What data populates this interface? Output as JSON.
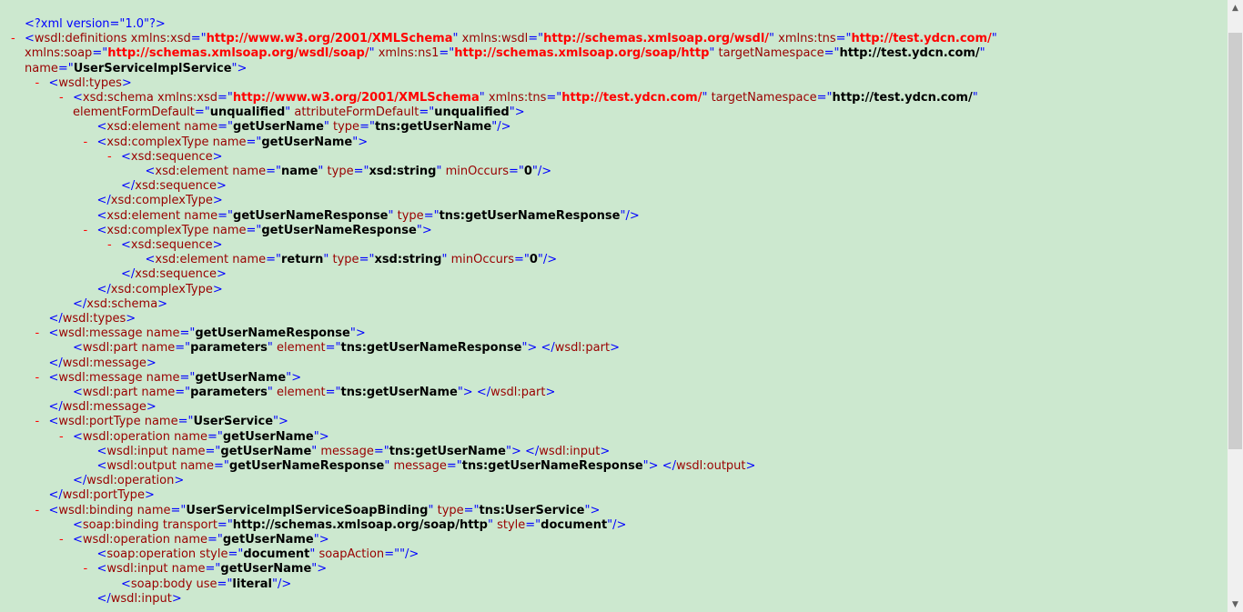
{
  "xml_viewer": {
    "lines": [
      {
        "d": "<?xml version=\"1.0\"?>",
        "m": false,
        "i": 0
      },
      {
        "d": "<wsdl:definitions xmlns:xsd=\"http://www.w3.org/2001/XMLSchema\" xmlns:wsdl=\"http://schemas.xmlsoap.org/wsdl/\" xmlns:tns=\"http://test.ydcn.com/\"",
        "m": true,
        "i": 0
      },
      {
        "d": "xmlns:soap=\"http://schemas.xmlsoap.org/wsdl/soap/\" xmlns:ns1=\"http://schemas.xmlsoap.org/soap/http\" targetNamespace=\"http://test.ydcn.com/\"",
        "m": false,
        "i": 0
      },
      {
        "d": "name=\"UserServiceImplService\">",
        "m": false,
        "i": 0
      },
      {
        "d": "<wsdl:types>",
        "m": true,
        "i": 1
      },
      {
        "d": "<xsd:schema xmlns:xsd=\"http://www.w3.org/2001/XMLSchema\" xmlns:tns=\"http://test.ydcn.com/\" targetNamespace=\"http://test.ydcn.com/\"",
        "m": true,
        "i": 2
      },
      {
        "d": "elementFormDefault=\"unqualified\" attributeFormDefault=\"unqualified\">",
        "m": false,
        "i": 2
      },
      {
        "d": "<xsd:element name=\"getUserName\" type=\"tns:getUserName\"/>",
        "m": false,
        "i": 3
      },
      {
        "d": "<xsd:complexType name=\"getUserName\">",
        "m": true,
        "i": 3
      },
      {
        "d": "<xsd:sequence>",
        "m": true,
        "i": 4
      },
      {
        "d": "<xsd:element name=\"name\" type=\"xsd:string\" minOccurs=\"0\"/>",
        "m": false,
        "i": 5
      },
      {
        "d": "</xsd:sequence>",
        "m": false,
        "i": 4
      },
      {
        "d": "</xsd:complexType>",
        "m": false,
        "i": 3
      },
      {
        "d": "<xsd:element name=\"getUserNameResponse\" type=\"tns:getUserNameResponse\"/>",
        "m": false,
        "i": 3
      },
      {
        "d": "<xsd:complexType name=\"getUserNameResponse\">",
        "m": true,
        "i": 3
      },
      {
        "d": "<xsd:sequence>",
        "m": true,
        "i": 4
      },
      {
        "d": "<xsd:element name=\"return\" type=\"xsd:string\" minOccurs=\"0\"/>",
        "m": false,
        "i": 5
      },
      {
        "d": "</xsd:sequence>",
        "m": false,
        "i": 4
      },
      {
        "d": "</xsd:complexType>",
        "m": false,
        "i": 3
      },
      {
        "d": "</xsd:schema>",
        "m": false,
        "i": 2
      },
      {
        "d": "</wsdl:types>",
        "m": false,
        "i": 1
      },
      {
        "d": "<wsdl:message name=\"getUserNameResponse\">",
        "m": true,
        "i": 1
      },
      {
        "d": "<wsdl:part name=\"parameters\" element=\"tns:getUserNameResponse\"> </wsdl:part>",
        "m": false,
        "i": 2
      },
      {
        "d": "</wsdl:message>",
        "m": false,
        "i": 1
      },
      {
        "d": "<wsdl:message name=\"getUserName\">",
        "m": true,
        "i": 1
      },
      {
        "d": "<wsdl:part name=\"parameters\" element=\"tns:getUserName\"> </wsdl:part>",
        "m": false,
        "i": 2
      },
      {
        "d": "</wsdl:message>",
        "m": false,
        "i": 1
      },
      {
        "d": "<wsdl:portType name=\"UserService\">",
        "m": true,
        "i": 1
      },
      {
        "d": "<wsdl:operation name=\"getUserName\">",
        "m": true,
        "i": 2
      },
      {
        "d": "<wsdl:input name=\"getUserName\" message=\"tns:getUserName\"> </wsdl:input>",
        "m": false,
        "i": 3
      },
      {
        "d": "<wsdl:output name=\"getUserNameResponse\" message=\"tns:getUserNameResponse\"> </wsdl:output>",
        "m": false,
        "i": 3
      },
      {
        "d": "</wsdl:operation>",
        "m": false,
        "i": 2
      },
      {
        "d": "</wsdl:portType>",
        "m": false,
        "i": 1
      },
      {
        "d": "<wsdl:binding name=\"UserServiceImplServiceSoapBinding\" type=\"tns:UserService\">",
        "m": true,
        "i": 1
      },
      {
        "d": "<soap:binding transport=\"http://schemas.xmlsoap.org/soap/http\" style=\"document\"/>",
        "m": false,
        "i": 2
      },
      {
        "d": "<wsdl:operation name=\"getUserName\">",
        "m": true,
        "i": 2
      },
      {
        "d": "<soap:operation style=\"document\" soapAction=\"\"/>",
        "m": false,
        "i": 3
      },
      {
        "d": "<wsdl:input name=\"getUserName\">",
        "m": true,
        "i": 3
      },
      {
        "d": "<soap:body use=\"literal\"/>",
        "m": false,
        "i": 4
      },
      {
        "d": "</wsdl:input>",
        "m": false,
        "i": 3
      }
    ],
    "marker_char": "-"
  },
  "scrollbar": {
    "up_arrow_icon": "triangle-up-icon",
    "down_arrow_icon": "triangle-down-icon"
  }
}
